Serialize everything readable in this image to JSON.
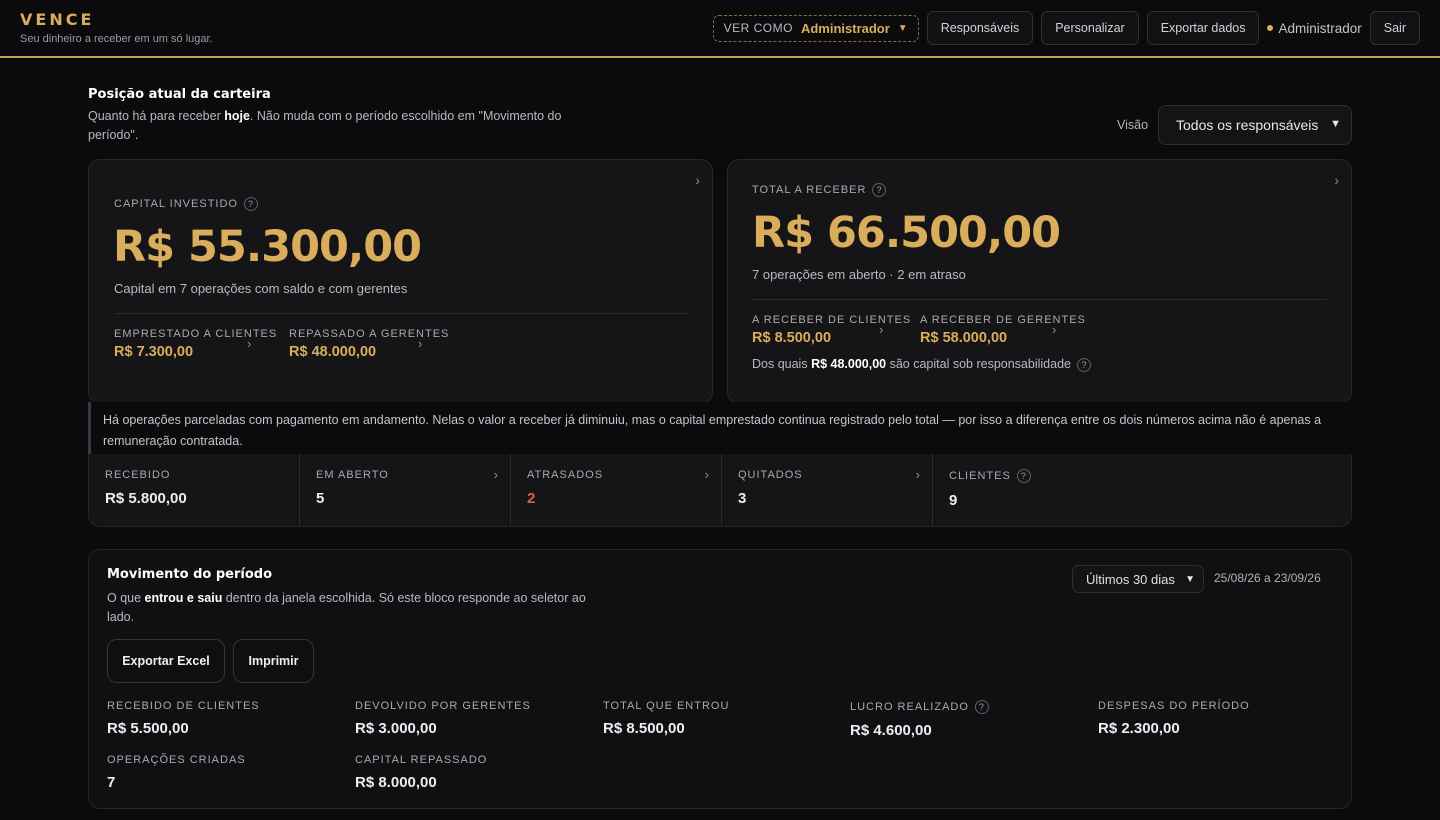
{
  "header": {
    "brand": "VENCE",
    "tagline": "Seu dinheiro a receber em um só lugar.",
    "view_as_label": "VER COMO",
    "view_as_value": "Administrador",
    "buttons": [
      "Responsáveis",
      "Personalizar",
      "Exportar dados"
    ],
    "user": "Administrador",
    "logout": "Sair"
  },
  "position": {
    "title": "Posição atual da carteira",
    "desc_prefix": "Quanto há para receber ",
    "desc_bold": "hoje",
    "desc_suffix": ". Não muda com o período escolhido em \"Movimento do período\".",
    "view_label": "Visão",
    "view_value": "Todos os responsáveis"
  },
  "capital_card": {
    "label": "CAPITAL INVESTIDO",
    "amount": "R$ 55.300,00",
    "subtitle": "Capital em 7 operações com saldo e com gerentes",
    "left_label": "EMPRESTADO A CLIENTES",
    "left_amount": "R$ 7.300,00",
    "right_label": "REPASSADO A GERENTES",
    "right_amount": "R$ 48.000,00"
  },
  "receivable_card": {
    "label": "TOTAL A RECEBER",
    "amount": "R$ 66.500,00",
    "subtitle": "7 operações em aberto · 2 em atraso",
    "left_label": "A RECEBER DE CLIENTES",
    "left_amount": "R$ 8.500,00",
    "right_label": "A RECEBER DE GERENTES",
    "right_amount": "R$ 58.000,00",
    "note_prefix": "Dos quais ",
    "note_bold": "R$ 48.000,00",
    "note_suffix": " são capital sob responsabilidade"
  },
  "notice": "Há operações parceladas com pagamento em andamento. Nelas o valor a receber já diminuiu, mas o capital emprestado continua registrado pelo total — por isso a diferença entre os dois números acima não é apenas a remuneração contratada.",
  "stats": [
    {
      "label": "RECEBIDO",
      "value": "R$ 5.800,00"
    },
    {
      "label": "EM ABERTO",
      "value": "5"
    },
    {
      "label": "ATRASADOS",
      "value": "2"
    },
    {
      "label": "QUITADOS",
      "value": "3"
    },
    {
      "label": "CLIENTES",
      "value": "9"
    }
  ],
  "movement": {
    "title": "Movimento do período",
    "desc_prefix": "O que ",
    "desc_bold": "entrou e saiu",
    "desc_suffix": " dentro da janela escolhida. Só este bloco responde ao seletor ao lado.",
    "period_value": "Últimos 30 dias",
    "period_range": "25/08/26 a 23/09/26",
    "export_excel": "Exportar Excel",
    "print": "Imprimir",
    "metrics": [
      {
        "label": "RECEBIDO DE CLIENTES",
        "value": "R$ 5.500,00"
      },
      {
        "label": "DEVOLVIDO POR GERENTES",
        "value": "R$ 3.000,00"
      },
      {
        "label": "TOTAL QUE ENTROU",
        "value": "R$ 8.500,00"
      },
      {
        "label": "LUCRO REALIZADO",
        "value": "R$ 4.600,00"
      },
      {
        "label": "DESPESAS DO PERÍODO",
        "value": "R$ 2.300,00"
      },
      {
        "label": "OPERAÇÕES CRIADAS",
        "value": "7"
      },
      {
        "label": "CAPITAL REPASSADO",
        "value": "R$ 8.000,00"
      }
    ]
  },
  "colors": {
    "accent": "#d9ad5b",
    "danger": "#e05d52",
    "background": "#0b0b0d",
    "card": "#151518"
  },
  "icons": [
    "chevron-down-icon",
    "chevron-right-icon",
    "help-icon",
    "status-dot-icon"
  ]
}
